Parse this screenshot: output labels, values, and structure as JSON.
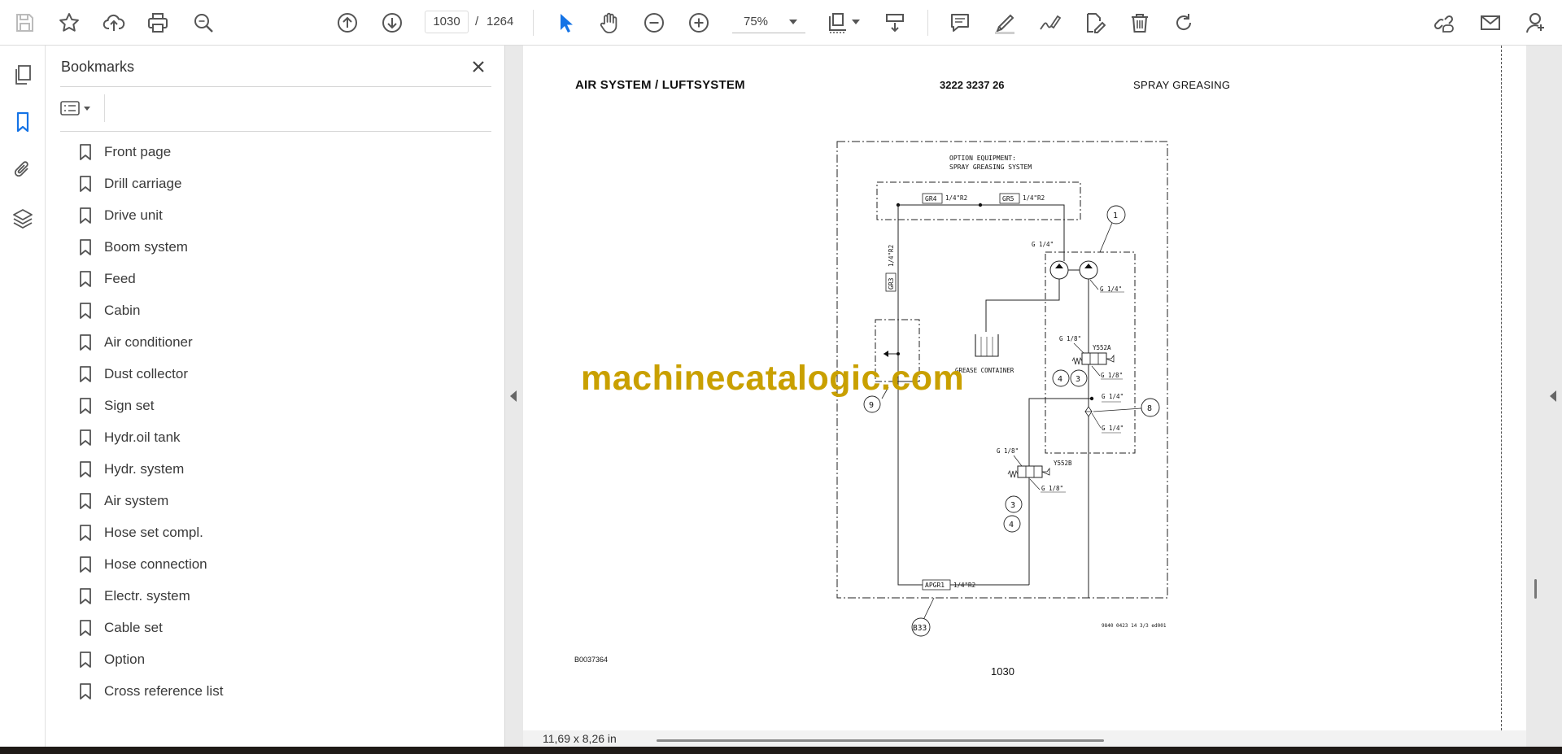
{
  "toolbar": {
    "current_page": "1030",
    "page_separator": "/",
    "total_pages": "1264",
    "zoom": "75%"
  },
  "bookmarks": {
    "title": "Bookmarks",
    "items": [
      {
        "label": "Front page"
      },
      {
        "label": "Drill carriage"
      },
      {
        "label": "Drive unit"
      },
      {
        "label": "Boom system"
      },
      {
        "label": "Feed"
      },
      {
        "label": "Cabin"
      },
      {
        "label": "Air conditioner"
      },
      {
        "label": "Dust collector"
      },
      {
        "label": "Sign set"
      },
      {
        "label": "Hydr.oil tank"
      },
      {
        "label": "Hydr. system"
      },
      {
        "label": "Air system"
      },
      {
        "label": "Hose set compl."
      },
      {
        "label": "Hose connection"
      },
      {
        "label": "Electr. system"
      },
      {
        "label": "Cable set"
      },
      {
        "label": "Option"
      },
      {
        "label": "Cross reference list"
      }
    ]
  },
  "document": {
    "header_left": "AIR SYSTEM / LUFTSYSTEM",
    "header_mid": "3222 3237 26",
    "header_right": "SPRAY GREASING",
    "doc_code": "B0037364",
    "page_number": "1030",
    "watermark": "machinecatalogic.com",
    "diagram": {
      "note_line1": "OPTION EQUIPMENT:",
      "note_line2": "SPRAY GREASING SYSTEM",
      "gr4": "GR4",
      "gr5": "GR5",
      "gr3": "GR3",
      "apgr1": "APGR1",
      "hose_14r2": "1/4\"R2",
      "g14": "G 1/4\"",
      "g18": "G 1/8\"",
      "y552a": "Y552A",
      "y552b": "Y552B",
      "grease_container": "GREASE CONTAINER",
      "c1": "1",
      "c3": "3",
      "c4": "4",
      "c8": "8",
      "c9": "9",
      "b33": "B33",
      "drawing_ref": "9840 0423 14 3/3 ed001"
    }
  },
  "status": {
    "page_size": "11,69 x 8,26 in"
  }
}
